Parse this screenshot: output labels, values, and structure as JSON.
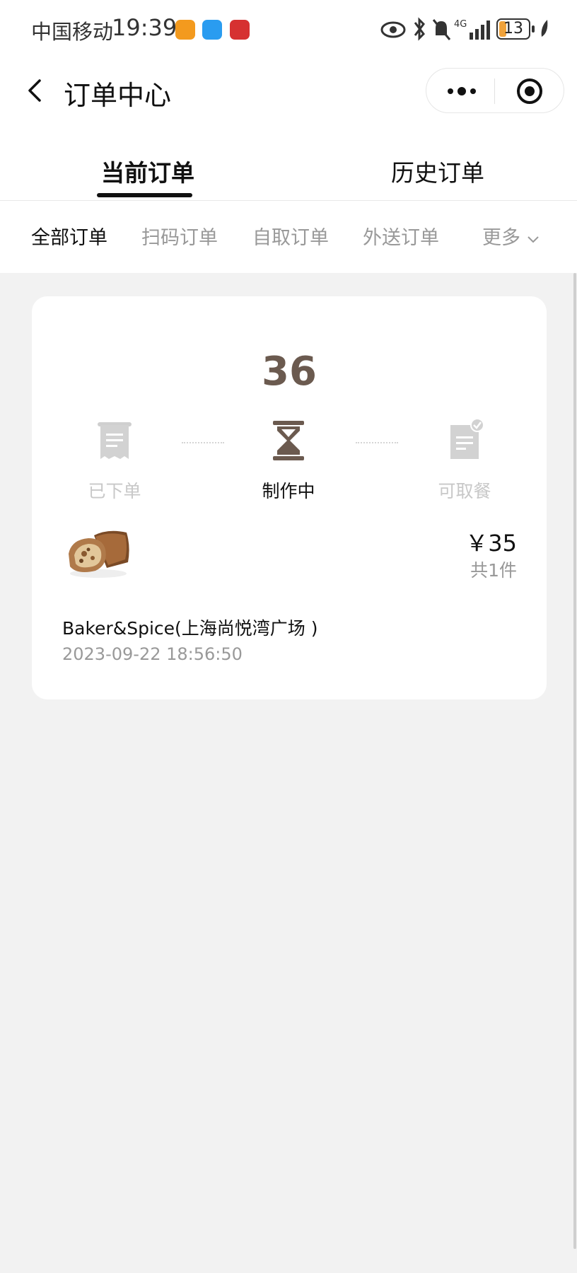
{
  "status_bar": {
    "carrier": "中国移动",
    "time": "19:39",
    "battery": "13",
    "network": "4G"
  },
  "nav": {
    "title": "订单中心",
    "back_icon": "chevron-left-icon",
    "more_icon": "more-dots-icon",
    "close_icon": "target-close-icon"
  },
  "tabs": [
    {
      "label": "当前订单",
      "active": true
    },
    {
      "label": "历史订单",
      "active": false
    }
  ],
  "subtabs": [
    {
      "label": "全部订单",
      "active": true
    },
    {
      "label": "扫码订单",
      "active": false
    },
    {
      "label": "自取订单",
      "active": false
    },
    {
      "label": "外送订单",
      "active": false
    },
    {
      "label": "更多",
      "active": false
    }
  ],
  "order": {
    "queue_number": "36",
    "steps": [
      {
        "label": "已下单",
        "icon": "receipt-icon",
        "active": false
      },
      {
        "label": "制作中",
        "icon": "hourglass-icon",
        "active": true
      },
      {
        "label": "可取餐",
        "icon": "document-check-icon",
        "active": false
      }
    ],
    "price": "￥35",
    "item_count": "共1件",
    "store": "Baker&Spice(上海尚悦湾广场 )",
    "datetime": "2023-09-22 18:56:50"
  },
  "colors": {
    "accent_brown": "#6b5a4f",
    "background": "#f2f2f2"
  }
}
